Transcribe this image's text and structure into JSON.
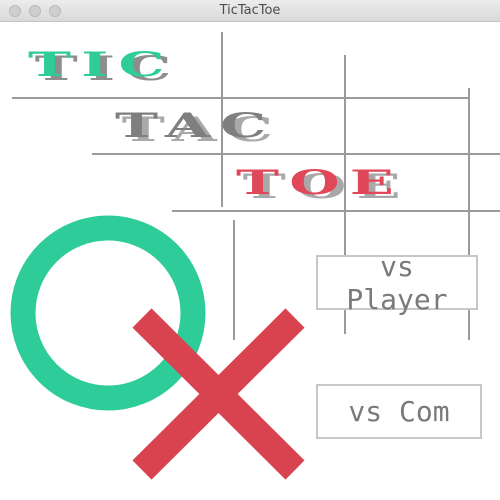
{
  "window": {
    "title": "TicTacToe"
  },
  "title_words": [
    "TIC",
    "TAC",
    "TOE"
  ],
  "menu": {
    "vs_player_label": "vs Player",
    "vs_com_label": "vs Com"
  },
  "colors": {
    "o_mark": "#2ecc98",
    "x_mark": "#d9434f",
    "tic": "#2ecc98",
    "tac": "#7f7f7f",
    "toe": "#e0485a",
    "grid_lines": "#9a9a9a"
  },
  "decorations": {
    "o_icon": "o-mark-icon",
    "x_icon": "x-mark-icon"
  }
}
